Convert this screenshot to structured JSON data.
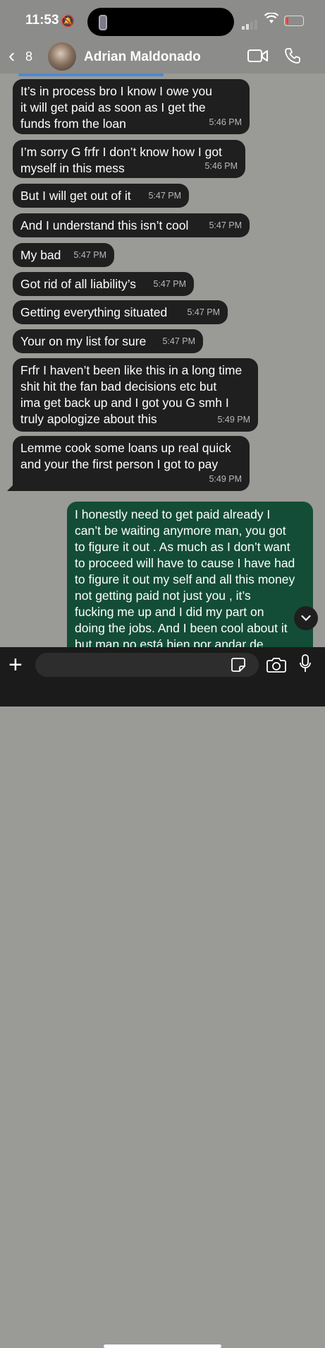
{
  "status_bar": {
    "time": "11:53"
  },
  "header": {
    "back_count": "8",
    "contact_name": "Adrian Maldonado"
  },
  "messages": [
    {
      "text": "It’s in process bro I know I owe you\nit will get paid as soon as I get the\nfunds from the loan",
      "time": "5:46 PM",
      "direction": "incoming"
    },
    {
      "text": "I’m sorry G frfr I don’t know how I got\nmyself in this mess",
      "time": "5:46 PM",
      "direction": "incoming"
    },
    {
      "text": "But I will get out of it",
      "time": "5:47 PM",
      "direction": "incoming"
    },
    {
      "text": "And I understand this isn’t cool",
      "time": "5:47 PM",
      "direction": "incoming"
    },
    {
      "text": "My bad",
      "time": "5:47 PM",
      "direction": "incoming"
    },
    {
      "text": "Got rid of all liability’s",
      "time": "5:47 PM",
      "direction": "incoming"
    },
    {
      "text": "Getting everything situated",
      "time": "5:47 PM",
      "direction": "incoming"
    },
    {
      "text": "Your on my list for sure",
      "time": "5:47 PM",
      "direction": "incoming"
    },
    {
      "text": "Frfr I haven’t been like this in a long time\nshit hit the fan bad decisions etc but\nima get back up and I got you G smh I\ntruly apologize about this",
      "time": "5:49 PM",
      "direction": "incoming"
    },
    {
      "text": "Lemme cook some loans up real quick\nand your the first person I got to pay",
      "time": "5:49 PM",
      "direction": "incoming"
    },
    {
      "text": "I honestly need to get paid already I\ncan’t be waiting anymore man, you got\nto figure it out . As much as I don’t want\nto proceed will have to cause I have had\nto figure it out my self and all this money\nnot getting paid not just you , it’s\nfucking me up and I did my part on\ndoing the jobs. And I been cool about it\nbut man no está bien por andar de",
      "time": "",
      "direction": "outgoing"
    }
  ],
  "colors": {
    "incoming_bubble": "#1f1f1f",
    "outgoing_bubble": "#134d37",
    "chat_background": "#9a9a96"
  },
  "icons": {
    "back": "chevron-left-icon",
    "video": "video-camera-icon",
    "phone": "phone-icon",
    "scroll": "chevron-down-icon",
    "attach": "plus-icon",
    "sticker": "sticker-icon",
    "camera": "camera-icon",
    "mic": "microphone-icon"
  }
}
